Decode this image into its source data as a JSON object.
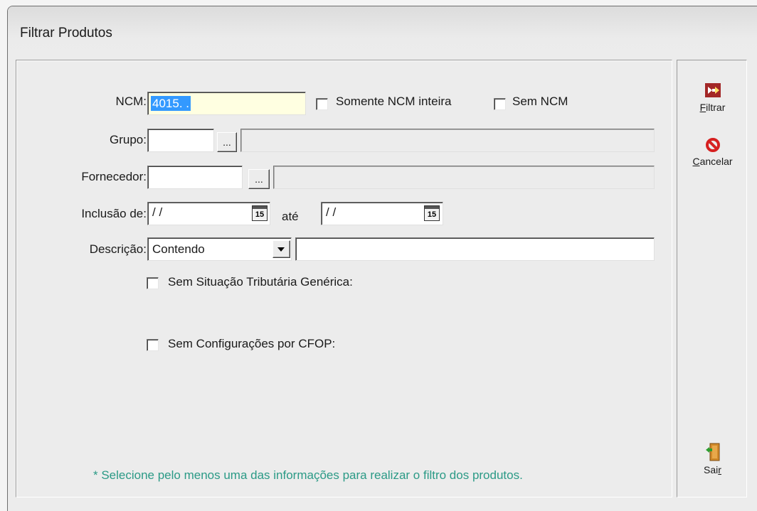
{
  "window": {
    "title": "Filtrar Produtos"
  },
  "ncm": {
    "label": "NCM:",
    "value": "4015.  .",
    "only_whole_label": "Somente NCM inteira",
    "no_ncm_label": "Sem NCM"
  },
  "grupo": {
    "label": "Grupo:",
    "browse_label": "..."
  },
  "fornecedor": {
    "label": "Fornecedor:",
    "browse_label": "..."
  },
  "inclusao": {
    "label": "Inclusão de:",
    "from_value": "/ /",
    "to_label": "até",
    "to_value": "/ /",
    "calendar_icon_text": "15"
  },
  "descricao": {
    "label": "Descrição:",
    "mode_selected": "Contendo",
    "text_value": ""
  },
  "options": {
    "sem_situacao_label": "Sem Situação Tributária Genérica:",
    "sem_cfop_label": "Sem Configurações por CFOP:"
  },
  "hint": "* Selecione pelo menos uma das informações para realizar o filtro dos produtos.",
  "sidebar": {
    "filtrar": {
      "label_access": "F",
      "label_rest": "iltrar"
    },
    "cancelar": {
      "label_access": "C",
      "label_rest": "ancelar"
    },
    "sair": {
      "label_start": "Sai",
      "label_access": "r"
    }
  },
  "colors": {
    "hint": "#2b9a86",
    "selection": "#3399ff",
    "ncm_field_bg": "#ffffe1"
  }
}
